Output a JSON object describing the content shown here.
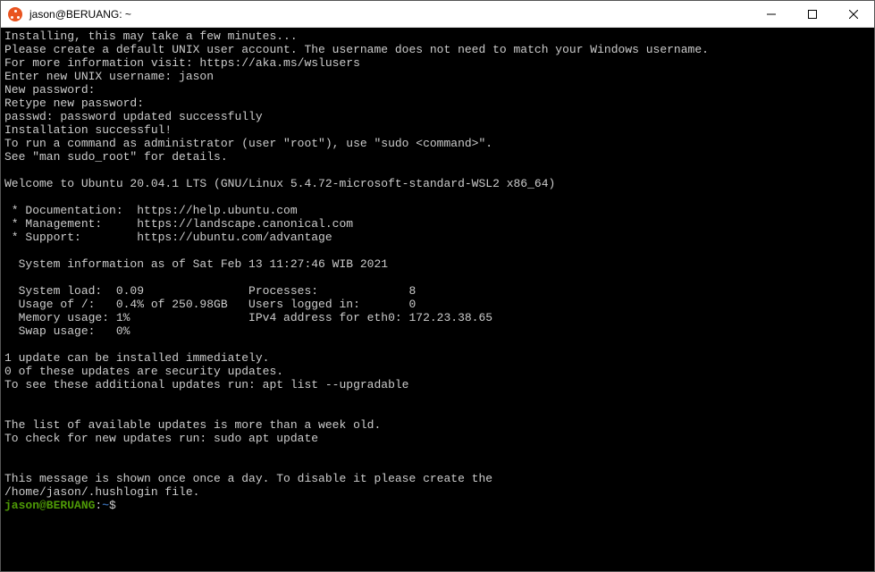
{
  "window": {
    "title": "jason@BERUANG: ~"
  },
  "terminal": {
    "lines": [
      "Installing, this may take a few minutes...",
      "Please create a default UNIX user account. The username does not need to match your Windows username.",
      "For more information visit: https://aka.ms/wslusers",
      "Enter new UNIX username: jason",
      "New password:",
      "Retype new password:",
      "passwd: password updated successfully",
      "Installation successful!",
      "To run a command as administrator (user \"root\"), use \"sudo <command>\".",
      "See \"man sudo_root\" for details.",
      "",
      "Welcome to Ubuntu 20.04.1 LTS (GNU/Linux 5.4.72-microsoft-standard-WSL2 x86_64)",
      "",
      " * Documentation:  https://help.ubuntu.com",
      " * Management:     https://landscape.canonical.com",
      " * Support:        https://ubuntu.com/advantage",
      "",
      "  System information as of Sat Feb 13 11:27:46 WIB 2021",
      "",
      "  System load:  0.09               Processes:             8",
      "  Usage of /:   0.4% of 250.98GB   Users logged in:       0",
      "  Memory usage: 1%                 IPv4 address for eth0: 172.23.38.65",
      "  Swap usage:   0%",
      "",
      "1 update can be installed immediately.",
      "0 of these updates are security updates.",
      "To see these additional updates run: apt list --upgradable",
      "",
      "",
      "The list of available updates is more than a week old.",
      "To check for new updates run: sudo apt update",
      "",
      "",
      "This message is shown once once a day. To disable it please create the",
      "/home/jason/.hushlogin file."
    ],
    "prompt": {
      "user": "jason@BERUANG",
      "colon": ":",
      "path": "~",
      "dollar": "$"
    }
  }
}
